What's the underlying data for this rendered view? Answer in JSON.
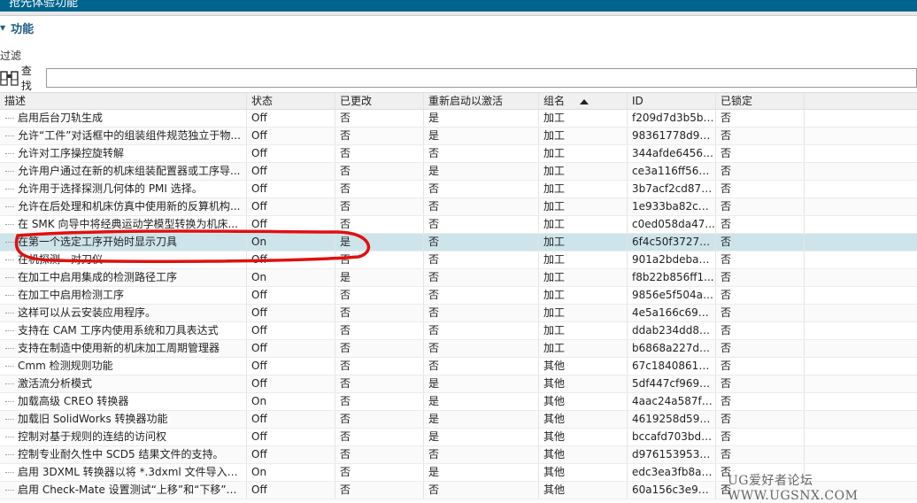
{
  "window": {
    "title": "抢先体验功能"
  },
  "section": {
    "title": "功能"
  },
  "filter": {
    "label": "过滤",
    "search_label": "查找",
    "search_value": ""
  },
  "columns": [
    "描述",
    "状态",
    "已更改",
    "重新启动以激活",
    "组名",
    "ID",
    "已锁定"
  ],
  "rows": [
    {
      "desc": "启用后台刀轨生成",
      "status": "Off",
      "changed": "否",
      "restart": "是",
      "group": "加工",
      "id": "f209d7d3b5bf...",
      "locked": "否"
    },
    {
      "desc": "允许“工件”对话框中的组装组件规范独立于物...",
      "status": "Off",
      "changed": "否",
      "restart": "是",
      "group": "加工",
      "id": "98361778d99...",
      "locked": "否"
    },
    {
      "desc": "允许对工序操控旋转解",
      "status": "Off",
      "changed": "否",
      "restart": "否",
      "group": "加工",
      "id": "344afde64564...",
      "locked": "否"
    },
    {
      "desc": "允许用户通过在新的机床组装配置器或工序导...",
      "status": "Off",
      "changed": "否",
      "restart": "是",
      "group": "加工",
      "id": "ce3a116ff563...",
      "locked": "否"
    },
    {
      "desc": "允许用于选择探测几何体的 PMI 选择。",
      "status": "Off",
      "changed": "否",
      "restart": "否",
      "group": "加工",
      "id": "3b7acf2cd873...",
      "locked": "否"
    },
    {
      "desc": "允许在后处理和机床仿真中使用新的反算机构...",
      "status": "Off",
      "changed": "否",
      "restart": "否",
      "group": "加工",
      "id": "1e933ba82cbf...",
      "locked": "否"
    },
    {
      "desc": "在 SMK 向导中将经典运动学模型转换为机床...",
      "status": "Off",
      "changed": "否",
      "restart": "否",
      "group": "加工",
      "id": "c0ed058da47...",
      "locked": "否"
    },
    {
      "desc": "在第一个选定工序开始时显示刀具",
      "status": "On",
      "changed": "是",
      "restart": "否",
      "group": "加工",
      "id": "6f4c50f3727d...",
      "locked": "否",
      "selected": true
    },
    {
      "desc": "在机探测 - 对刀仪",
      "status": "Off",
      "changed": "否",
      "restart": "否",
      "group": "加工",
      "id": "901a2bdeba1...",
      "locked": "否"
    },
    {
      "desc": "在加工中启用集成的检测路径工序",
      "status": "On",
      "changed": "是",
      "restart": "否",
      "group": "加工",
      "id": "f8b22b856ff1...",
      "locked": "否"
    },
    {
      "desc": "在加工中启用检测工序",
      "status": "Off",
      "changed": "否",
      "restart": "否",
      "group": "加工",
      "id": "9856e5f504a5...",
      "locked": "否"
    },
    {
      "desc": "这样可以从云安装应用程序。",
      "status": "Off",
      "changed": "否",
      "restart": "否",
      "group": "加工",
      "id": "4e5a166c6950...",
      "locked": "否"
    },
    {
      "desc": "支持在 CAM 工序内使用系统和刀具表达式",
      "status": "Off",
      "changed": "否",
      "restart": "否",
      "group": "加工",
      "id": "ddab234dd80...",
      "locked": "否"
    },
    {
      "desc": "支持在制造中使用新的机床加工周期管理器",
      "status": "Off",
      "changed": "否",
      "restart": "否",
      "group": "加工",
      "id": "b6868a227d6...",
      "locked": "否"
    },
    {
      "desc": "Cmm 检测规则功能",
      "status": "Off",
      "changed": "否",
      "restart": "否",
      "group": "其他",
      "id": "67c18408615c...",
      "locked": "否"
    },
    {
      "desc": "激活流分析模式",
      "status": "Off",
      "changed": "否",
      "restart": "是",
      "group": "其他",
      "id": "5df447cf9690...",
      "locked": "否"
    },
    {
      "desc": "加载高级 CREO 转换器",
      "status": "On",
      "changed": "否",
      "restart": "是",
      "group": "其他",
      "id": "4aac24a587fd...",
      "locked": "否"
    },
    {
      "desc": "加载旧 SolidWorks 转换器功能",
      "status": "Off",
      "changed": "否",
      "restart": "是",
      "group": "其他",
      "id": "4619258d59c...",
      "locked": "否"
    },
    {
      "desc": "控制对基于规则的连结的访问权",
      "status": "Off",
      "changed": "否",
      "restart": "是",
      "group": "其他",
      "id": "bccafd703bd9...",
      "locked": "否"
    },
    {
      "desc": "控制专业耐久性中 SCD5 结果文件的支持。",
      "status": "Off",
      "changed": "否",
      "restart": "否",
      "group": "其他",
      "id": "d976153953e...",
      "locked": "否"
    },
    {
      "desc": "启用 3DXML 转换器以将 *.3dxml 文件导入或...",
      "status": "On",
      "changed": "否",
      "restart": "是",
      "group": "其他",
      "id": "edc3ea3fb8a4...",
      "locked": "否"
    },
    {
      "desc": "启用 Check-Mate 设置测试“上移”和“下移”按...",
      "status": "Off",
      "changed": "否",
      "restart": "否",
      "group": "其他",
      "id": "60a156c3e968...",
      "locked": "否"
    }
  ],
  "watermark": "UG爱好者论坛 WWW.UGSNX.COM",
  "colors": {
    "titlebar": "#00648c",
    "selected_row": "#cde4ea",
    "annotation": "#e01010"
  }
}
